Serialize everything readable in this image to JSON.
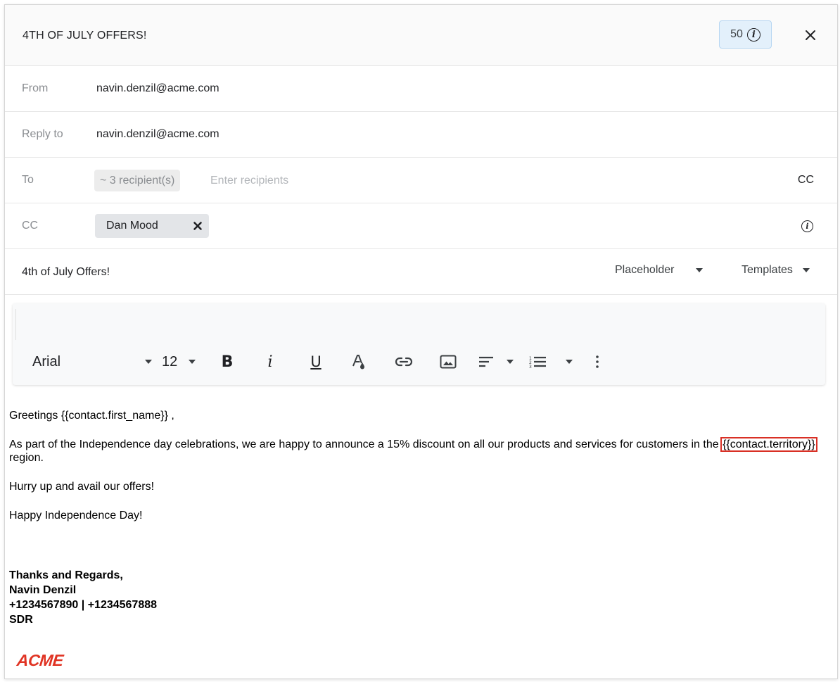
{
  "dialog": {
    "title": "4TH OF JULY OFFERS!",
    "count": "50",
    "info_icon": "info-icon",
    "close_icon": "close-icon"
  },
  "fields": {
    "from_label": "From",
    "from_value": "navin.denzil@acme.com",
    "reply_label": "Reply to",
    "reply_value": "navin.denzil@acme.com",
    "to_label": "To",
    "to_chip": "~ 3 recipient(s)",
    "to_placeholder": "Enter recipients",
    "cc_link": "CC",
    "cc_label": "CC",
    "cc_chip": "Dan Mood"
  },
  "subject": {
    "value": "4th of July Offers!",
    "placeholder_menu": "Placeholder",
    "templates_menu": "Templates"
  },
  "toolbar": {
    "font": "Arial",
    "size": "12",
    "bold": "B",
    "italic": "i",
    "underline": "U"
  },
  "body": {
    "greeting": "Greetings {{contact.first_name}} ,",
    "para1_pre": "As part of the Independence day celebrations, we are happy to announce a 15% discount on all our products and services for customers in the ",
    "para1_token": "{{contact.territory}}",
    "para1_post": " region.",
    "para2": "Hurry up and avail our offers!",
    "para3": "Happy Independence Day!",
    "sig1": "Thanks and Regards,",
    "sig2": "Navin Denzil",
    "sig3": "+1234567890 | +1234567888",
    "sig4": "SDR",
    "logo": "ACME"
  },
  "colors": {
    "accent_badge": "#e3f0fb",
    "highlight": "#d93025",
    "logo": "#e03323"
  }
}
